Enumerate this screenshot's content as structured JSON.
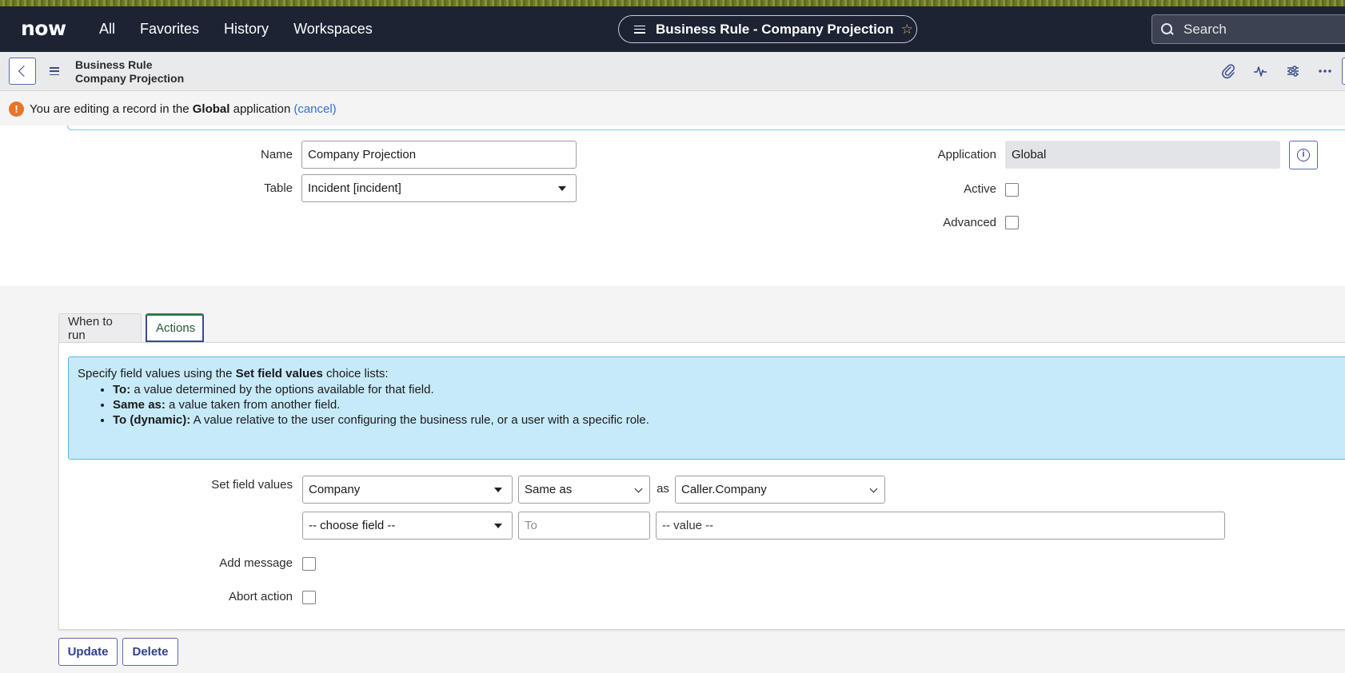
{
  "top_nav": {
    "logo_text": "now",
    "items": [
      "All",
      "Favorites",
      "History",
      "Workspaces"
    ],
    "record_pill_title": "Business Rule - Company Projection",
    "search_placeholder": "Search"
  },
  "record_header": {
    "type": "Business Rule",
    "name": "Company Projection"
  },
  "notice": {
    "prefix": "You are editing a record in the",
    "app": "Global",
    "suffix": "application",
    "cancel_link": "(cancel)"
  },
  "form": {
    "name_label": "Name",
    "name_value": "Company Projection",
    "table_label": "Table",
    "table_value": "Incident [incident]",
    "application_label": "Application",
    "application_value": "Global",
    "active_label": "Active",
    "active_checked": false,
    "advanced_label": "Advanced",
    "advanced_checked": false
  },
  "tabs": {
    "items": [
      "When to run",
      "Actions"
    ],
    "active": "Actions"
  },
  "actions_panel": {
    "info_intro_prefix": "Specify field values using the",
    "info_intro_bold": "Set field values",
    "info_intro_suffix": "choice lists:",
    "bullets": [
      {
        "term": "To:",
        "text": "a value determined by the options available for that field."
      },
      {
        "term": "Same as:",
        "text": "a value taken from another field."
      },
      {
        "term": "To (dynamic):",
        "text": "A value relative to the user configuring the business rule, or a user with a specific role."
      }
    ],
    "set_field_values_label": "Set field values",
    "row1": {
      "field": "Company",
      "operator": "Same as",
      "as_label": "as",
      "value": "Caller.Company"
    },
    "row2": {
      "field": "-- choose field --",
      "operator": "To",
      "value": "-- value --"
    },
    "add_message_label": "Add message",
    "add_message_checked": false,
    "abort_action_label": "Abort action",
    "abort_action_checked": false
  },
  "buttons": {
    "update": "Update",
    "delete": "Delete"
  },
  "colors": {
    "header_bg": "#1c2333",
    "accent": "#3b4a8c",
    "info_box_bg": "#c7eaf9",
    "warn": "#e8742a"
  }
}
